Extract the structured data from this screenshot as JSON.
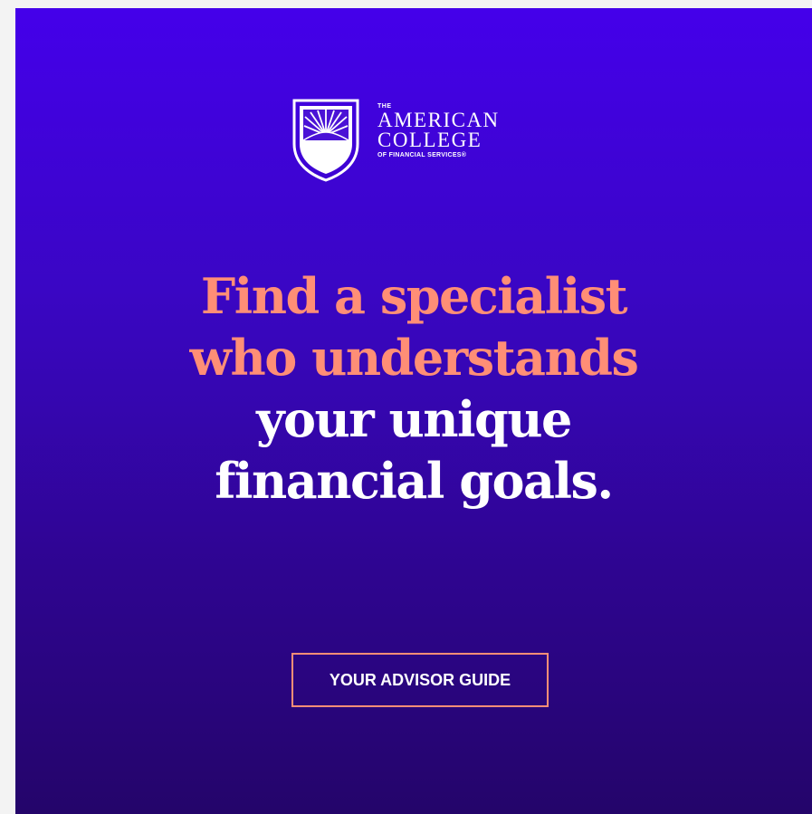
{
  "logo": {
    "the": "THE",
    "line1": "AMERICAN",
    "line2": "COLLEGE",
    "line3": "OF FINANCIAL SERVICES®"
  },
  "headline": {
    "accent_line1": "Find a specialist",
    "accent_line2": "who understands",
    "plain_line1": "your unique",
    "plain_line2": "financial goals."
  },
  "cta": {
    "label": "YOUR ADVISOR GUIDE"
  },
  "colors": {
    "background_top": "#4400ea",
    "background_bottom": "#24056a",
    "accent": "#ff8e76",
    "text": "#ffffff"
  }
}
